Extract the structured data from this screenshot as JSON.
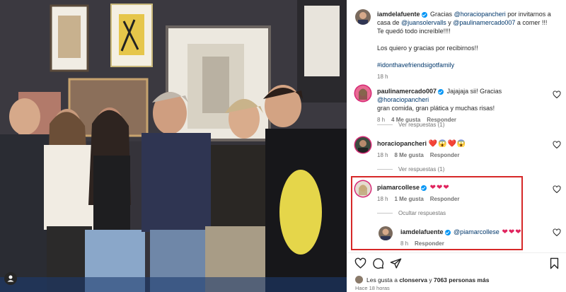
{
  "post": {
    "author": "iamdelafuente",
    "caption": {
      "prefix": "Gracias ",
      "mention1": "@horaciopancheri",
      "part2": " por invitarnos a casa de ",
      "mention2": "@juansolervalls",
      "part3": " y ",
      "mention3": "@paulinamercado007",
      "part4": " a comer !!!",
      "line2": "Te quedó todo increíble!!!!",
      "line3": "Los quiero y gracias por recibirnos!!",
      "hashtag": "#idonthavefriendsigotfamily"
    },
    "time": "18 h"
  },
  "comments": [
    {
      "user": "paulinamercado007",
      "text_pre": "Jajajaja sii! Gracias ",
      "mention": "@horaciopancheri",
      "text_post": "gran comida, gran plática y muchas risas!",
      "time": "8 h",
      "likes": "4 Me gusta",
      "reply": "Responder",
      "view_replies": "Ver respuestas (1)"
    },
    {
      "user": "horaciopancheri",
      "text": "❤️😱❤️😱",
      "time": "18 h",
      "likes": "8 Me gusta",
      "reply": "Responder",
      "view_replies": "Ver respuestas (1)"
    },
    {
      "user": "piamarcollese",
      "text": "❤❤❤",
      "time": "18 h",
      "likes": "1 Me gusta",
      "reply": "Responder",
      "hide_replies": "Ocultar respuestas",
      "reply_item": {
        "user": "iamdelafuente",
        "mention": "@piamarcollese",
        "text": " ❤❤❤",
        "time": "8 h",
        "reply": "Responder"
      }
    }
  ],
  "footer": {
    "liked_prefix": "Les gusta a ",
    "liked_user": "clonserva",
    "liked_mid": " y ",
    "liked_count": "7063 personas más",
    "time": "Hace 18 horas"
  },
  "colors": {
    "link": "#00376b",
    "verified": "#0095f6",
    "highlight": "#d62828",
    "heart": "#e0245e"
  }
}
